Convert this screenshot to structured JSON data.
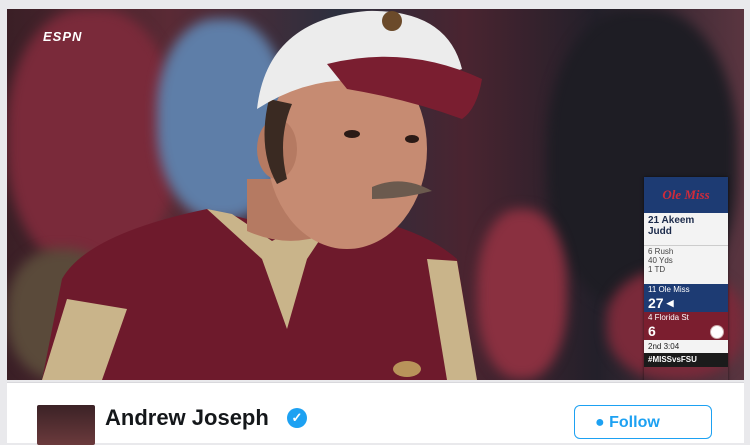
{
  "broadcast": {
    "network": "ESPN"
  },
  "scorebug": {
    "player_line1": "21 Akeem",
    "player_line2": "Judd",
    "stat1": "6 Rush",
    "stat2": "40 Yds",
    "stat3": "1 TD",
    "team1_name": "11 Ole Miss",
    "team1_score": "27",
    "team2_name": "4 Florida St",
    "team2_score": "6",
    "clock": "2nd  3:04",
    "hashtag": "#MISSvsFSU"
  },
  "tweet": {
    "author_name": "Andrew Joseph",
    "follow_label": "Follow"
  },
  "colors": {
    "twitter_blue": "#1da1f2",
    "ole_miss_navy": "#1d3b73",
    "fsu_garnet": "#7b1e2f"
  }
}
